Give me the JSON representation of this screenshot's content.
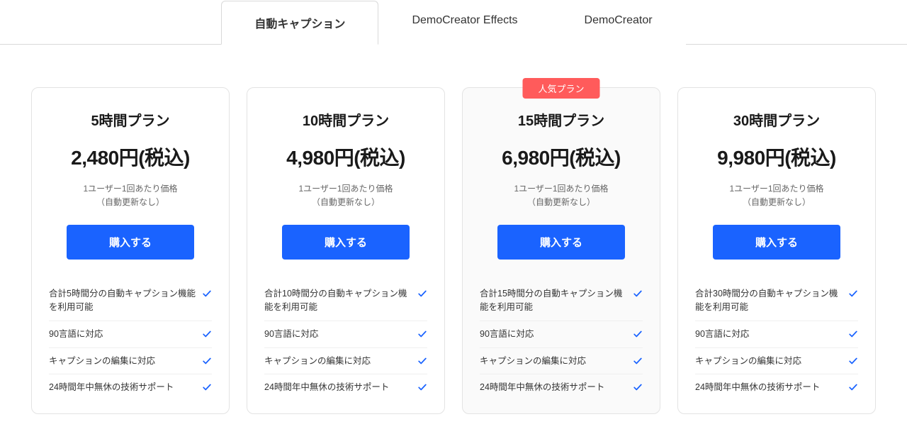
{
  "tabs": [
    {
      "label": "自動キャプション",
      "active": true
    },
    {
      "label": "DemoCreator Effects",
      "active": false
    },
    {
      "label": "DemoCreator",
      "active": false
    }
  ],
  "badge_label": "人気プラン",
  "buy_label": "購入する",
  "sub_line1": "1ユーザー1回あたり価格",
  "sub_line2": "（自動更新なし）",
  "plans": [
    {
      "title": "5時間プラン",
      "price": "2,480円(税込)",
      "popular": false,
      "features": [
        "合計5時間分の自動キャプション機能を利用可能",
        "90言語に対応",
        "キャプションの編集に対応",
        "24時間年中無休の技術サポート"
      ]
    },
    {
      "title": "10時間プラン",
      "price": "4,980円(税込)",
      "popular": false,
      "features": [
        "合計10時間分の自動キャプション機能を利用可能",
        "90言語に対応",
        "キャプションの編集に対応",
        "24時間年中無休の技術サポート"
      ]
    },
    {
      "title": "15時間プラン",
      "price": "6,980円(税込)",
      "popular": true,
      "features": [
        "合計15時間分の自動キャプション機能を利用可能",
        "90言語に対応",
        "キャプションの編集に対応",
        "24時間年中無休の技術サポート"
      ]
    },
    {
      "title": "30時間プラン",
      "price": "9,980円(税込)",
      "popular": false,
      "features": [
        "合計30時間分の自動キャプション機能を利用可能",
        "90言語に対応",
        "キャプションの編集に対応",
        "24時間年中無休の技術サポート"
      ]
    }
  ]
}
